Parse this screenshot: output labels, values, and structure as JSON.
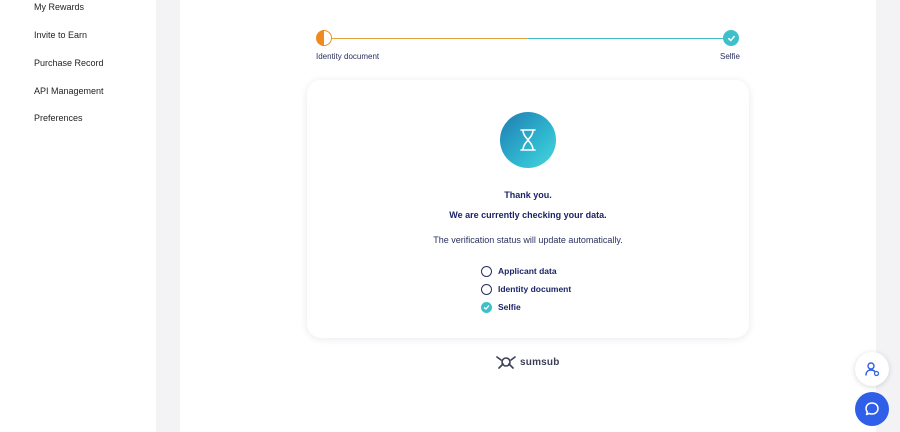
{
  "sidebar": {
    "items": [
      {
        "label": "My Rewards"
      },
      {
        "label": "Invite to Earn"
      },
      {
        "label": "Purchase Record"
      },
      {
        "label": "API Management"
      },
      {
        "label": "Preferences"
      }
    ]
  },
  "progress": {
    "start_label": "Identity document",
    "end_label": "Selfie"
  },
  "card": {
    "thanks": "Thank you.",
    "checking": "We are currently checking your data.",
    "auto_update": "The verification status will update automatically.",
    "checklist": [
      {
        "label": "Applicant data",
        "status": "pending"
      },
      {
        "label": "Identity document",
        "status": "pending"
      },
      {
        "label": "Selfie",
        "status": "done"
      }
    ]
  },
  "brand": {
    "name": "sumsub"
  },
  "colors": {
    "accent_orange": "#ef8a1f",
    "accent_teal": "#3fbfc9",
    "text_navy": "#1b2567",
    "chat_blue": "#2f5fe8"
  }
}
